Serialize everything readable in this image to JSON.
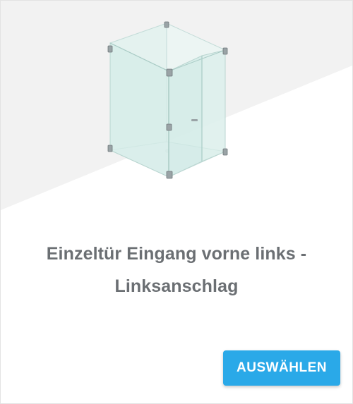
{
  "card": {
    "title_line1": "Einzeltür Eingang vorne links -",
    "title_line2": "Linksanschlag",
    "select_label": "AUSWÄHLEN"
  },
  "colors": {
    "accent": "#2aa9e8",
    "title_text": "#6b6f73",
    "background_shade": "#f2f2f2"
  }
}
